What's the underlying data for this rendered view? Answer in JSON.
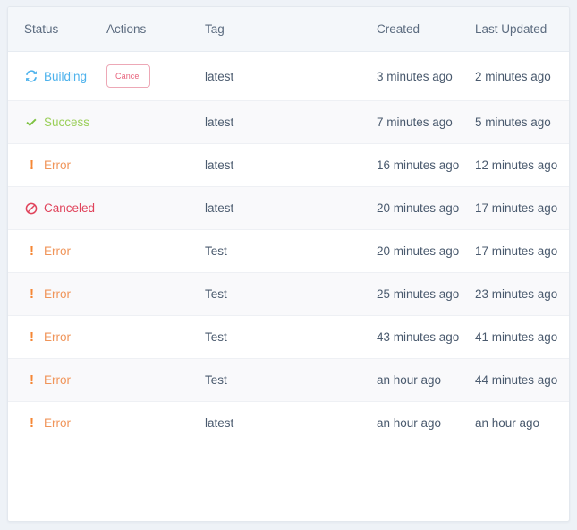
{
  "table": {
    "columns": [
      {
        "key": "status",
        "label": "Status"
      },
      {
        "key": "actions",
        "label": "Actions"
      },
      {
        "key": "tag",
        "label": "Tag"
      },
      {
        "key": "created",
        "label": "Created"
      },
      {
        "key": "updated",
        "label": "Last Updated"
      }
    ],
    "rows": [
      {
        "status": "Building",
        "status_icon": "sync-icon",
        "status_color": "#4db2ec",
        "action_label": "Cancel",
        "has_action": true,
        "tag": "latest",
        "created": "3 minutes ago",
        "updated": "2 minutes ago"
      },
      {
        "status": "Success",
        "status_icon": "check-icon",
        "status_color": "#9bcf5a",
        "action_label": "",
        "has_action": false,
        "tag": "latest",
        "created": "7 minutes ago",
        "updated": "5 minutes ago"
      },
      {
        "status": "Error",
        "status_icon": "exclamation-icon",
        "status_color": "#f0955a",
        "action_label": "",
        "has_action": false,
        "tag": "latest",
        "created": "16 minutes ago",
        "updated": "12 minutes ago"
      },
      {
        "status": "Canceled",
        "status_icon": "ban-icon",
        "status_color": "#e0435b",
        "action_label": "",
        "has_action": false,
        "tag": "latest",
        "created": "20 minutes ago",
        "updated": "17 minutes ago"
      },
      {
        "status": "Error",
        "status_icon": "exclamation-icon",
        "status_color": "#f0955a",
        "action_label": "",
        "has_action": false,
        "tag": "Test",
        "created": "20 minutes ago",
        "updated": "17 minutes ago"
      },
      {
        "status": "Error",
        "status_icon": "exclamation-icon",
        "status_color": "#f0955a",
        "action_label": "",
        "has_action": false,
        "tag": "Test",
        "created": "25 minutes ago",
        "updated": "23 minutes ago"
      },
      {
        "status": "Error",
        "status_icon": "exclamation-icon",
        "status_color": "#f0955a",
        "action_label": "",
        "has_action": false,
        "tag": "Test",
        "created": "43 minutes ago",
        "updated": "41 minutes ago"
      },
      {
        "status": "Error",
        "status_icon": "exclamation-icon",
        "status_color": "#f0955a",
        "action_label": "",
        "has_action": false,
        "tag": "Test",
        "created": "an hour ago",
        "updated": "44 minutes ago"
      },
      {
        "status": "Error",
        "status_icon": "exclamation-icon",
        "status_color": "#f0955a",
        "action_label": "",
        "has_action": false,
        "tag": "latest",
        "created": "an hour ago",
        "updated": "an hour ago"
      }
    ]
  },
  "theme": {
    "page_background": "#eef2f7",
    "card_background": "#ffffff",
    "header_background": "#f4f7fa",
    "stripe_background": "#f9f9fb",
    "border_color": "#e6ebf1",
    "text_color": "#4a5a6e",
    "header_text_color": "#5b6b7f",
    "building_color": "#4db2ec",
    "success_color": "#9bcf5a",
    "error_color": "#f0955a",
    "canceled_color": "#e0435b",
    "cancel_button_border": "#eda8b6",
    "cancel_button_text": "#e8637c"
  }
}
